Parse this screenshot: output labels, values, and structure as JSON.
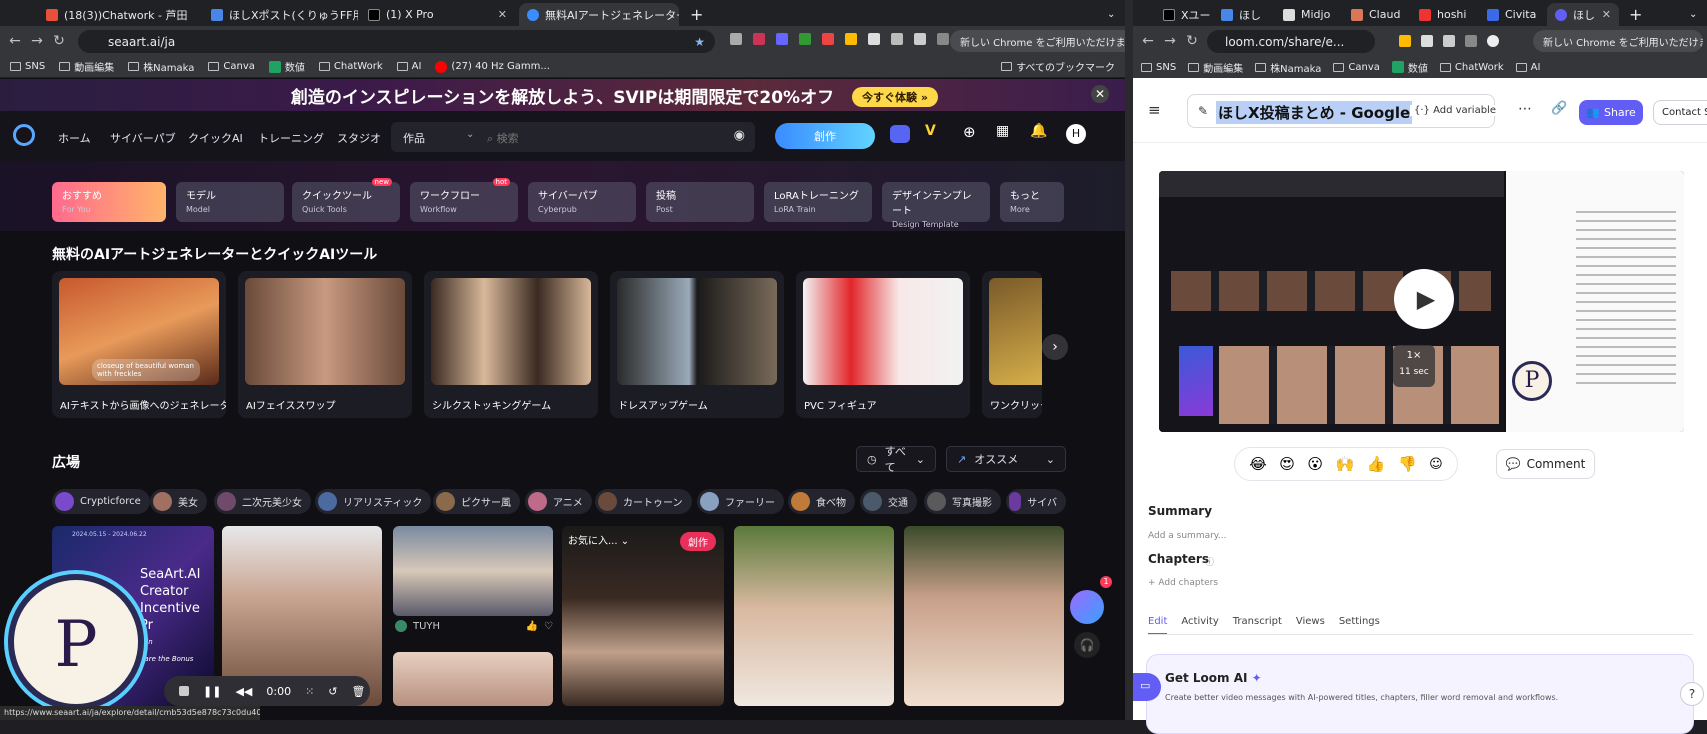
{
  "left_browser": {
    "tabs": [
      {
        "label": "(18(3))Chatwork - 芦田さん「(",
        "color": "#e8503a"
      },
      {
        "label": "ほしXポスト(くりゅうFF用) - G",
        "color": "#4a86e8"
      },
      {
        "label": "(1) X Pro",
        "color": "#000000"
      },
      {
        "label": "無料AIアートジェネレーター",
        "color": "#3a8cff"
      }
    ],
    "url": "seaart.ai/ja",
    "chrome_prompt": "新しい Chrome をご利用いただけます",
    "bookmarks": [
      "SNS",
      "動画編集",
      "株Namaka",
      "Canva",
      "数値",
      "ChatWork",
      "AI",
      "(27) 40 Hz Gamm...",
      "すべてのブックマーク"
    ],
    "status_url": "https://www.seaart.ai/ja/explore/detail/cmb53d5e878c73c0du40"
  },
  "seaart": {
    "banner_text": "創造のインスピレーションを解放しよう、SVIPは期間限定で20%オフ",
    "banner_button": "今すぐ体験 »",
    "nav": [
      "ホーム",
      "サイバーパブ",
      "クイックAI",
      "トレーニング",
      "スタジオ"
    ],
    "search_dropdown": "作品",
    "search_placeholder": "検索",
    "create_label": "創作",
    "categories": [
      {
        "label": "おすすめ",
        "sub": "For You",
        "badge": ""
      },
      {
        "label": "モデル",
        "sub": "Model",
        "badge": ""
      },
      {
        "label": "クイックツール",
        "sub": "Quick Tools",
        "badge": "new"
      },
      {
        "label": "ワークフロー",
        "sub": "Workflow",
        "badge": "hot"
      },
      {
        "label": "サイバーパブ",
        "sub": "Cyberpub",
        "badge": ""
      },
      {
        "label": "投稿",
        "sub": "Post",
        "badge": ""
      },
      {
        "label": "LoRAトレーニング",
        "sub": "LoRA Train",
        "badge": ""
      },
      {
        "label": "デザインテンプレート",
        "sub": "Design Template",
        "badge": ""
      },
      {
        "label": "もっと",
        "sub": "More",
        "badge": ""
      }
    ],
    "tools_heading": "無料のAIアートジェネレーターとクイックAIツール",
    "tools": [
      "AIテキストから画像へのジェネレーター",
      "AIフェイススワップ",
      "シルクストッキングゲーム",
      "ドレスアップゲーム",
      "PVC フィギュア",
      "ワンクリックで画"
    ],
    "tool_overlay": "closeup of beautiful woman with freckles",
    "plaza_heading": "広場",
    "filter_all": "すべて",
    "filter_sort": "オススメ",
    "chips": [
      "Crypticforce",
      "美女",
      "二次元美少女",
      "リアリスティック",
      "ピクサー風",
      "アニメ",
      "カートゥーン",
      "ファーリー",
      "食べ物",
      "交通",
      "写真撮影",
      "サイバ"
    ],
    "promo_card": {
      "line1": "SeaArt.AI",
      "line2": "Creator",
      "line3": "Incentive Pr",
      "line4": "Join",
      "line5": "hare the Bonus",
      "date": "2024.05.15 - 2024.06.22"
    },
    "card_user": "TUYH",
    "card_favorite": "お気に入...",
    "card_create": "創作",
    "notification_count": "1"
  },
  "recorder": {
    "time": "0:00"
  },
  "right_browser": {
    "url": "loom.com/share/e...",
    "chrome_prompt": "新しい Chrome をご利用いただけます",
    "tabs": [
      "Xユー",
      "ほし",
      "Midjo",
      "Claud",
      "hoshi",
      "Civita",
      "ほし"
    ],
    "bookmarks": [
      "SNS",
      "動画編集",
      "株Namaka",
      "Canva",
      "数値",
      "ChatWork",
      "AI"
    ]
  },
  "loom": {
    "title": "ほしX投稿まとめ - Google",
    "add_variable": "Add variable",
    "share": "Share",
    "contact": "Contact S",
    "speed": "1×",
    "duration": "11 sec",
    "reactions": [
      "😂",
      "😍",
      "😮",
      "🙌",
      "👍",
      "👎"
    ],
    "comment": "Comment",
    "summary_title": "Summary",
    "summary_placeholder": "Add a summary...",
    "chapters_title": "Chapters",
    "add_chapters": "+ Add chapters",
    "tabs": [
      "Edit",
      "Activity",
      "Transcript",
      "Views",
      "Settings"
    ],
    "ai_title": "Get Loom AI",
    "ai_text": "Create better video messages with AI-powered titles, chapters, filler word removal and workflows.",
    "help": "?"
  }
}
